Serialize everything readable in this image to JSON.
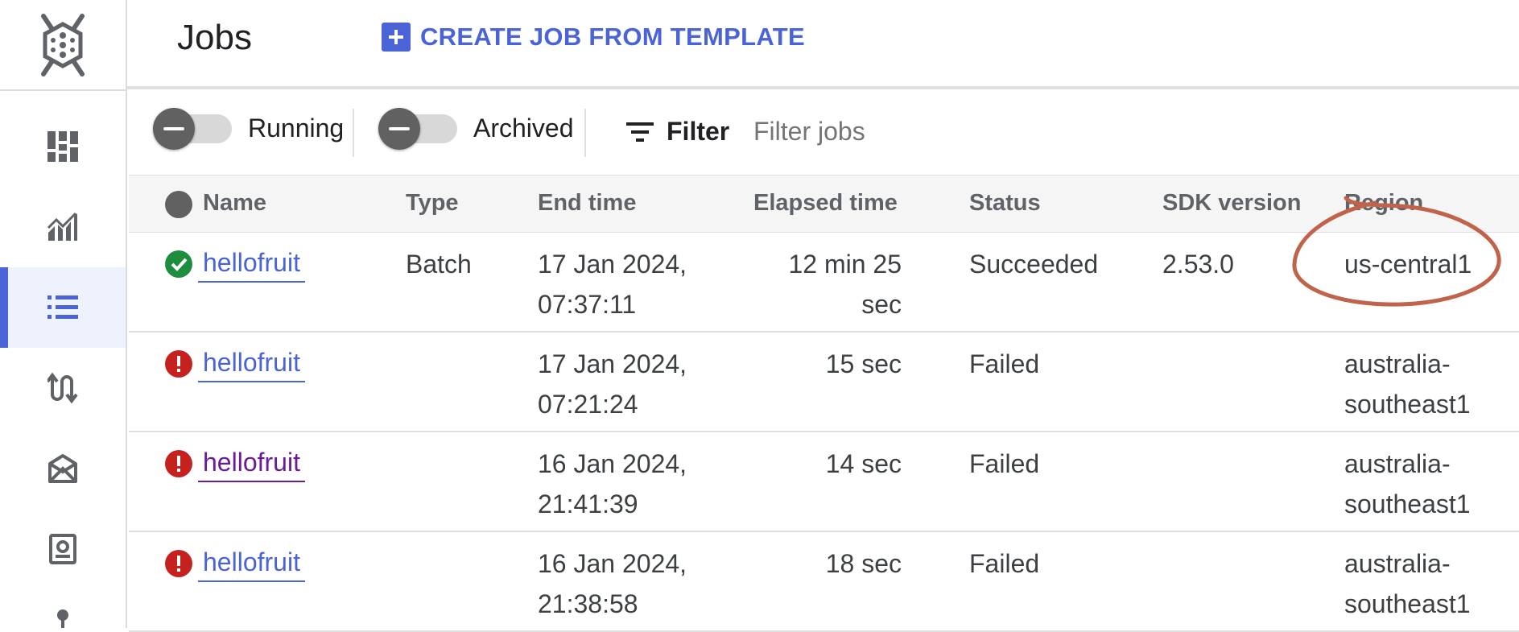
{
  "header": {
    "title": "Jobs",
    "create_button_label": "CREATE JOB FROM TEMPLATE"
  },
  "sidebar": {
    "items": [
      {
        "icon": "dashboard-icon"
      },
      {
        "icon": "monitoring-icon"
      },
      {
        "icon": "jobs-list-icon",
        "active": true
      },
      {
        "icon": "pipelines-icon"
      },
      {
        "icon": "workbench-icon"
      },
      {
        "icon": "snapshots-icon"
      },
      {
        "icon": "sql-icon"
      }
    ]
  },
  "toolbar": {
    "running_label": "Running",
    "archived_label": "Archived",
    "filter_label": "Filter",
    "filter_placeholder": "Filter jobs"
  },
  "table": {
    "columns": [
      "Name",
      "Type",
      "End time",
      "Elapsed time",
      "Status",
      "SDK version",
      "Region"
    ],
    "rows": [
      {
        "status_icon": "success-icon",
        "name": "hellofruit",
        "type": "Batch",
        "end_time_1": "17 Jan 2024,",
        "end_time_2": "07:37:11",
        "elapsed_1": "12 min 25",
        "elapsed_2": "sec",
        "status": "Succeeded",
        "sdk": "2.53.0",
        "region_1": "us-central1",
        "region_2": ""
      },
      {
        "status_icon": "error-icon",
        "name": "hellofruit",
        "type": "",
        "end_time_1": "17 Jan 2024,",
        "end_time_2": "07:21:24",
        "elapsed_1": "15 sec",
        "elapsed_2": "",
        "status": "Failed",
        "sdk": "",
        "region_1": "australia-",
        "region_2": "southeast1"
      },
      {
        "status_icon": "error-icon",
        "name": "hellofruit",
        "type": "",
        "end_time_1": "16 Jan 2024,",
        "end_time_2": "21:41:39",
        "elapsed_1": "14 sec",
        "elapsed_2": "",
        "status": "Failed",
        "sdk": "",
        "region_1": "australia-",
        "region_2": "southeast1"
      },
      {
        "status_icon": "error-icon",
        "name": "hellofruit",
        "type": "",
        "end_time_1": "16 Jan 2024,",
        "end_time_2": "21:38:58",
        "elapsed_1": "18 sec",
        "elapsed_2": "",
        "status": "Failed",
        "sdk": "",
        "region_1": "australia-",
        "region_2": "southeast1"
      }
    ]
  },
  "colors": {
    "accent": "#4a63d6",
    "success": "#1e8e3e",
    "error": "#c5221f",
    "visited_link": "#6a1b9a",
    "annotation": "#c0634a"
  }
}
